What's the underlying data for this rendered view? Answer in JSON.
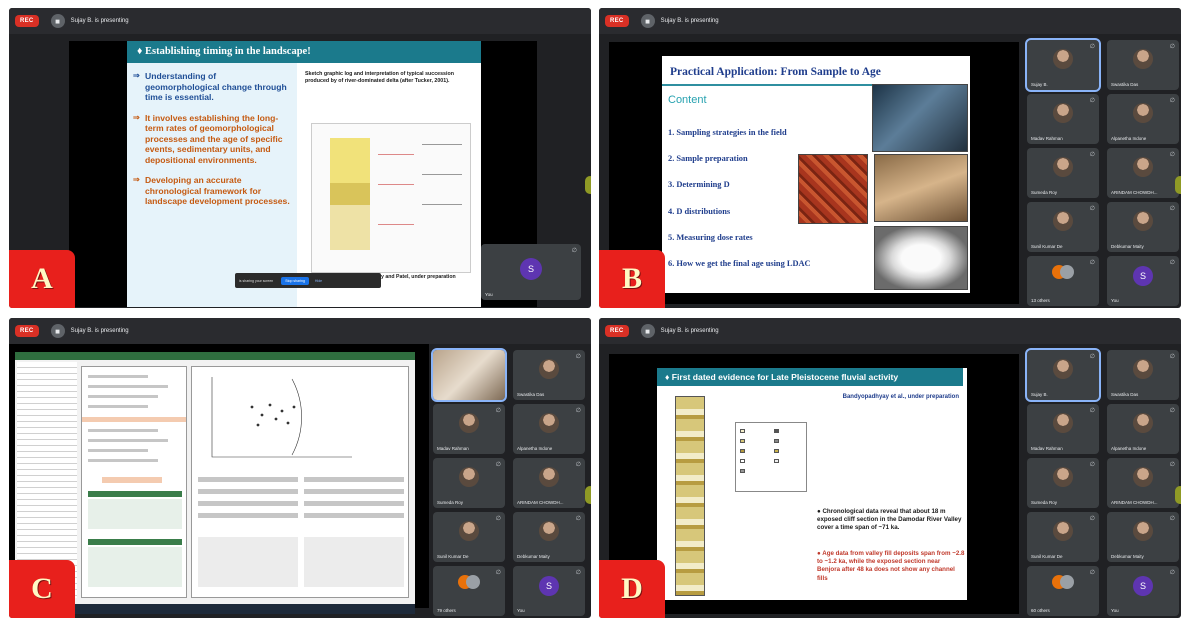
{
  "meeting": {
    "rec_label": "REC",
    "presenting_text": "Sujay B. is presenting"
  },
  "panels": [
    {
      "letter": "A"
    },
    {
      "letter": "B"
    },
    {
      "letter": "C"
    },
    {
      "letter": "D"
    }
  ],
  "slide_a": {
    "title": "Establishing timing in the landscape!",
    "points": [
      "Understanding of geomorphological change through time is essential.",
      "It involves establishing the long-term rates of geomorphological processes and the age of specific events, sedimentary units, and depositional environments.",
      "Developing an accurate chronological framework for landscape development processes."
    ],
    "caption": "Sketch graphic log and interpretation of typical succession produced by of river-dominated delta (after Tucker, 2001).",
    "citation": "y and Patel, under preparation",
    "share_notice": "is sharing your screen",
    "stop_button": "Stop sharing",
    "hide_button": "Hide"
  },
  "slide_b": {
    "title": "Practical Application: From Sample to Age",
    "content_heading": "Content",
    "items": [
      "1. Sampling strategies in the field",
      "2. Sample preparation",
      "3. Determining D",
      "4. D distributions",
      "5. Measuring dose rates",
      "6. How we get the final age using LDAC"
    ]
  },
  "slide_d": {
    "title": "First dated evidence for Late Pleistocene fluvial activity",
    "author": "Bandyopadhyay et al., under preparation",
    "bullet1": "Chronological data reveal that about 18 m exposed cliff section in the Damodar River Valley cover a time span of ~71 ka.",
    "bullet2": "Age data from valley fill deposits span from ~2.8 to ~1.2 ka, while the exposed section near Benjora after 48 ka does not show any channel fills"
  },
  "participants_b": [
    {
      "name": "Sujay B.",
      "active": true
    },
    {
      "name": "Swastika Das"
    },
    {
      "name": "Madav Rahman"
    },
    {
      "name": "Alpanetha Indone"
    },
    {
      "name": "Sumeda Roy"
    },
    {
      "name": "ARINDAM CHOWDH..."
    },
    {
      "name": "Sunil Kumar De"
    },
    {
      "name": "Debkumar Maity"
    },
    {
      "name": "13 others"
    },
    {
      "name": "You",
      "initial": "S"
    }
  ],
  "participants_c": [
    {
      "name": "Swastika Das"
    },
    {
      "name": "Madav Rahman"
    },
    {
      "name": "Alpanetha Indone"
    },
    {
      "name": "Sumeda Roy"
    },
    {
      "name": "ARINDAM CHOWDH..."
    },
    {
      "name": "Sunil Kumar De"
    },
    {
      "name": "Debkumar Maity"
    },
    {
      "name": "79 others"
    },
    {
      "name": "You",
      "initial": "S"
    }
  ],
  "participants_d": [
    {
      "name": "Sujay B.",
      "active": true
    },
    {
      "name": "Swastika Das"
    },
    {
      "name": "Madav Rahman"
    },
    {
      "name": "Alpanetha Indone"
    },
    {
      "name": "Sumeda Roy"
    },
    {
      "name": "ARINDAM CHOWDH..."
    },
    {
      "name": "Sunil Kumar De"
    },
    {
      "name": "Debkumar Maity"
    },
    {
      "name": "60 others"
    },
    {
      "name": "You",
      "initial": "S"
    }
  ],
  "self_tile_a": {
    "name": "You",
    "initial": "S"
  },
  "colors": {
    "rec": "#d93025",
    "badge": "#e8201c",
    "slide_header": "#1b7a8c",
    "active_border": "#8ab4f8"
  }
}
